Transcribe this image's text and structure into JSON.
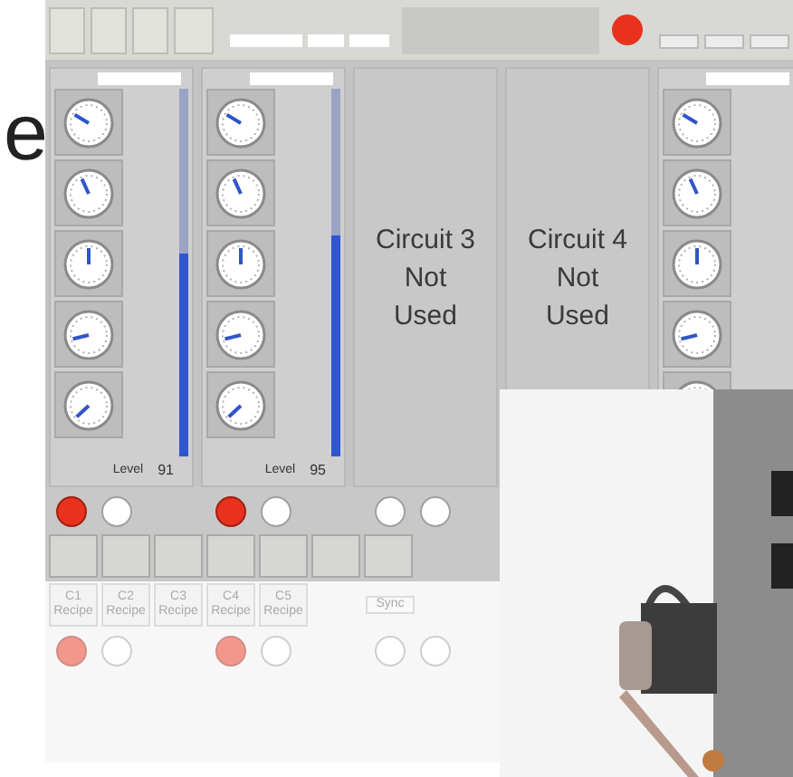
{
  "heading_fragment": "e",
  "circuits": [
    {
      "kind": "active",
      "level": 0.55,
      "level_label": "Level",
      "reading": "91"
    },
    {
      "kind": "active",
      "level": 0.6,
      "level_label": "Level",
      "reading": "95"
    },
    {
      "kind": "unused",
      "title": "Circuit 3\nNot\nUsed"
    },
    {
      "kind": "unused",
      "title": "Circuit 4\nNot\nUsed"
    },
    {
      "kind": "active"
    }
  ],
  "lamps": [
    {
      "on": true
    },
    {
      "on": false
    },
    {
      "on": true
    },
    {
      "on": false
    },
    {
      "on": false
    },
    {
      "on": false
    }
  ],
  "reflection": {
    "buttons": [
      "C1 Recipe",
      "C2 Recipe",
      "C3 Recipe",
      "C4 Recipe",
      "C5 Recipe"
    ],
    "sync": "Sync"
  }
}
